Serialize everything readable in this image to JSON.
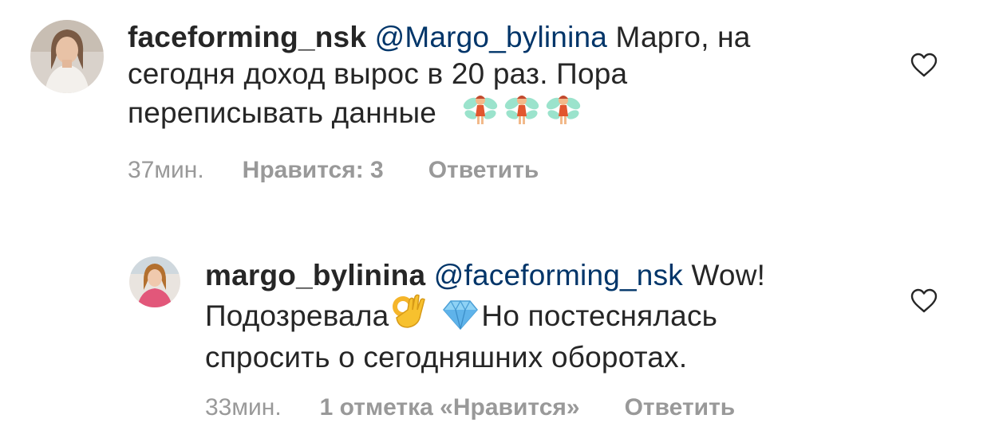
{
  "comments": [
    {
      "username": "faceforming_nsk",
      "mention": "@Margo_bylinina",
      "text_parts": [
        "Марго, на",
        "сегодня доход вырос в 20 раз. Пора",
        "переписывать данные"
      ],
      "emojis": [
        "fairy-emoji",
        "fairy-emoji",
        "fairy-emoji"
      ],
      "time": "37мин.",
      "likes": "Нравится: 3",
      "reply": "Ответить"
    },
    {
      "username": "margo_bylinina",
      "mention": "@faceforming_nsk",
      "text_parts": [
        "Wow!",
        "Подозревала",
        "Но постеснялась",
        "спросить о сегодняшних оборотах."
      ],
      "emojis": [
        "ok-hand-emoji",
        "gem-emoji"
      ],
      "time": "33мин.",
      "likes": "1 отметка «Нравится»",
      "reply": "Ответить"
    }
  ],
  "colors": {
    "text": "#262626",
    "mention": "#003569",
    "meta": "#999999",
    "heart": "#262626"
  }
}
